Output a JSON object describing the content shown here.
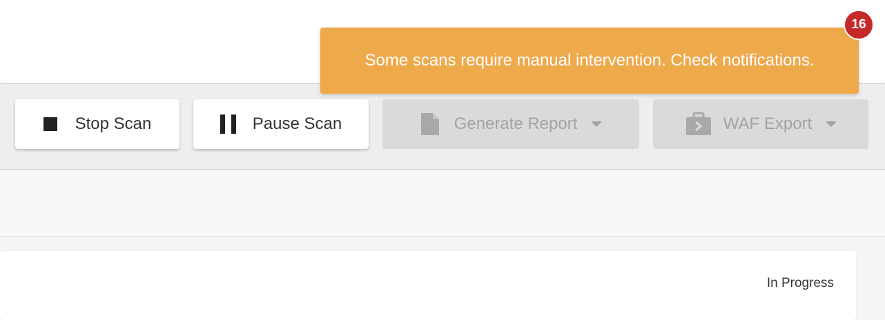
{
  "notifications": {
    "count": "16"
  },
  "toast": {
    "message": "Some scans require manual intervention. Check notifications.",
    "color": "#eea94b"
  },
  "toolbar": {
    "stop_scan": {
      "label": "Stop Scan",
      "icon": "stop-icon"
    },
    "pause_scan": {
      "label": "Pause Scan",
      "icon": "pause-icon"
    },
    "generate_report": {
      "label": "Generate Report",
      "icon": "document-icon",
      "disabled": true
    },
    "waf_export": {
      "label": "WAF Export",
      "icon": "briefcase-export-icon",
      "disabled": true
    }
  },
  "scan": {
    "status": "In Progress"
  },
  "colors": {
    "badge": "#c62828",
    "disabled_text": "#a3a3a3"
  }
}
